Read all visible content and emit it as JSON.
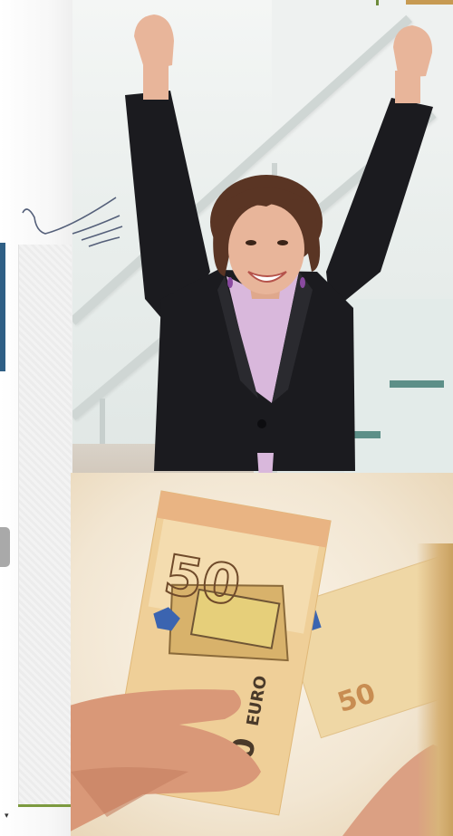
{
  "photos": {
    "top": {
      "subject": ""
    },
    "bottom": {
      "subject": ""
    }
  },
  "banknotes": {
    "front_value": "50",
    "back_value": "50",
    "currency_word": "EURO"
  },
  "colors": {
    "blazer": "#1b1b1f",
    "shirt": "#d9b8dc",
    "hair": "#5a3524",
    "skin": "#e8b59a",
    "banknote": "#efcf98",
    "banknote_accent": "#d36b45",
    "left_accent_blue": "#2f5f85",
    "divider_green": "#7c9a3f",
    "gold_edge": "#c9a160"
  },
  "icons": [
    "hand-sketch-icon",
    "scroll-down-icon"
  ]
}
